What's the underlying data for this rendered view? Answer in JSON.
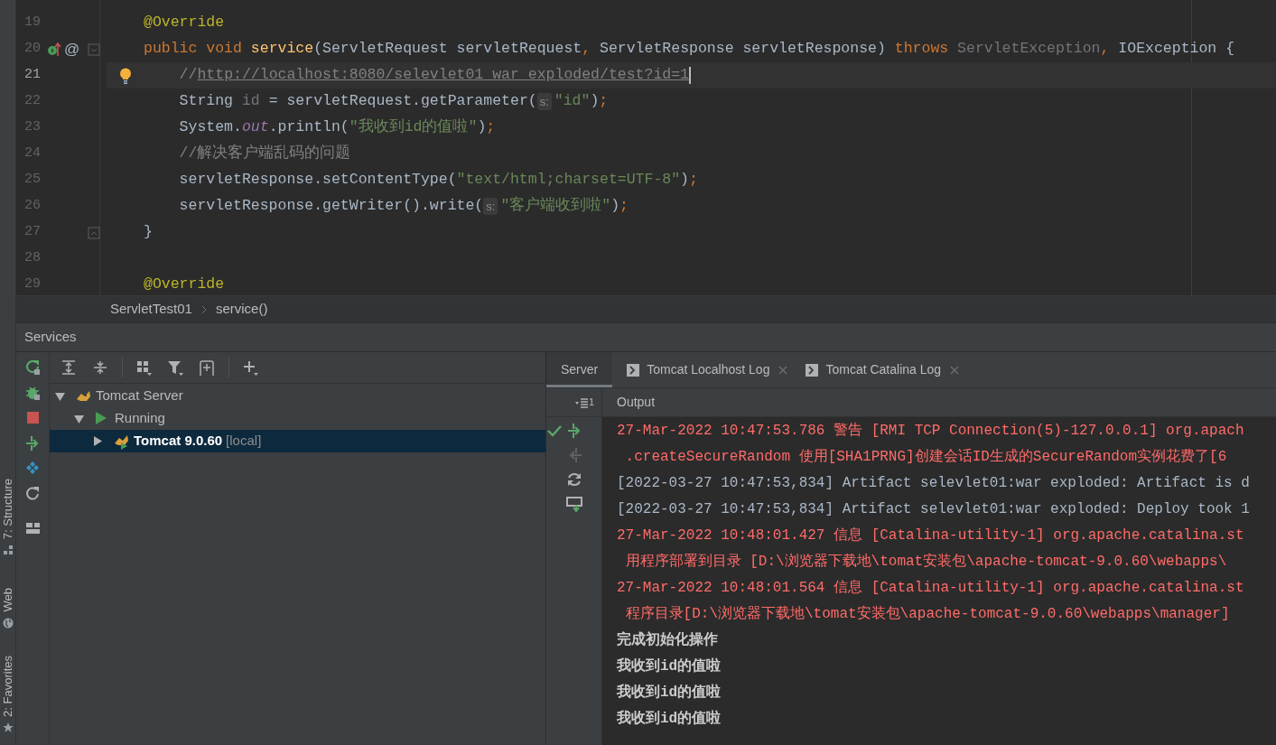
{
  "editor": {
    "lines": [
      {
        "number": "19",
        "current": false,
        "segments": [
          {
            "kind": "annotation",
            "text": "@Override"
          }
        ]
      },
      {
        "number": "20",
        "current": false,
        "override_marker": true,
        "gutter_text": "@",
        "fold_start": true,
        "segments": [
          {
            "kind": "keyword",
            "text": "public void "
          },
          {
            "kind": "method",
            "text": "service"
          },
          {
            "kind": "plain",
            "text": "(ServletRequest servletRequest"
          },
          {
            "kind": "keyword",
            "text": ", "
          },
          {
            "kind": "plain",
            "text": "ServletResponse servletResponse) "
          },
          {
            "kind": "keyword",
            "text": "throws "
          },
          {
            "kind": "unused",
            "text": "ServletException"
          },
          {
            "kind": "keyword",
            "text": ", "
          },
          {
            "kind": "plain",
            "text": "IOException {"
          }
        ]
      },
      {
        "number": "21",
        "current": true,
        "bulb": true,
        "segments": [
          {
            "kind": "comment",
            "text": "    //"
          },
          {
            "kind": "link",
            "text": "http://localhost:8080/selevlet01_war_exploded/test?id=1"
          }
        ]
      },
      {
        "number": "22",
        "current": false,
        "segments": [
          {
            "kind": "plain",
            "text": "    String "
          },
          {
            "kind": "unused",
            "text": "id"
          },
          {
            "kind": "plain",
            "text": " = servletRequest.getParameter("
          },
          {
            "kind": "hint",
            "text": "s:"
          },
          {
            "kind": "string",
            "text": "\"id\""
          },
          {
            "kind": "plain",
            "text": ")"
          },
          {
            "kind": "keyword",
            "text": ";"
          }
        ]
      },
      {
        "number": "23",
        "current": false,
        "segments": [
          {
            "kind": "plain",
            "text": "    System."
          },
          {
            "kind": "field",
            "text": "out"
          },
          {
            "kind": "plain",
            "text": ".println("
          },
          {
            "kind": "string",
            "text": "\"我收到id的值啦\""
          },
          {
            "kind": "plain",
            "text": ")"
          },
          {
            "kind": "keyword",
            "text": ";"
          }
        ]
      },
      {
        "number": "24",
        "current": false,
        "segments": [
          {
            "kind": "comment",
            "text": "    //解决客户端乱码的问题"
          }
        ]
      },
      {
        "number": "25",
        "current": false,
        "segments": [
          {
            "kind": "plain",
            "text": "    servletResponse.setContentType("
          },
          {
            "kind": "string",
            "text": "\"text/html;charset=UTF-8\""
          },
          {
            "kind": "plain",
            "text": ")"
          },
          {
            "kind": "keyword",
            "text": ";"
          }
        ]
      },
      {
        "number": "26",
        "current": false,
        "segments": [
          {
            "kind": "plain",
            "text": "    servletResponse.getWriter().write("
          },
          {
            "kind": "hint",
            "text": "s:"
          },
          {
            "kind": "string",
            "text": "\"客户端收到啦\""
          },
          {
            "kind": "plain",
            "text": ")"
          },
          {
            "kind": "keyword",
            "text": ";"
          }
        ]
      },
      {
        "number": "27",
        "current": false,
        "fold_end": true,
        "segments": [
          {
            "kind": "plain",
            "text": "}"
          }
        ]
      },
      {
        "number": "28",
        "current": false
      },
      {
        "number": "29",
        "current": false,
        "segments": [
          {
            "kind": "annotation",
            "text": "@Override"
          }
        ]
      }
    ]
  },
  "breadcrumb": [
    "ServletTest01",
    "service()"
  ],
  "services": {
    "title": "Services",
    "tree": [
      {
        "kind": "server",
        "label": "Tomcat Server",
        "expanded": true,
        "selected": false,
        "children": [
          {
            "kind": "state",
            "label": "Running",
            "expanded": true,
            "selected": false,
            "children": [
              {
                "kind": "instance",
                "label": "Tomcat 9.0.60",
                "detail": "[local]",
                "expanded": false,
                "selected": true
              }
            ]
          }
        ]
      }
    ]
  },
  "tabs": [
    {
      "label": "Server",
      "selected": true,
      "kind": "plain"
    },
    {
      "label": "Tomcat Localhost Log",
      "selected": false,
      "kind": "log"
    },
    {
      "label": "Tomcat Catalina Log",
      "selected": false,
      "kind": "log"
    }
  ],
  "output": {
    "title": "Output",
    "count": "1",
    "lines": [
      {
        "kind": "error",
        "text": "27-Mar-2022 10:47:53.786 警告 [RMI TCP Connection(5)-127.0.0.1] org.apach"
      },
      {
        "kind": "error",
        "text": " .createSecureRandom 使用[SHA1PRNG]创建会话ID生成的SecureRandom实例花费了[6"
      },
      {
        "kind": "info",
        "text": "[2022-03-27 10:47:53,834] Artifact selevlet01:war exploded: Artifact is d"
      },
      {
        "kind": "info",
        "text": "[2022-03-27 10:47:53,834] Artifact selevlet01:war exploded: Deploy took 1"
      },
      {
        "kind": "error",
        "text": "27-Mar-2022 10:48:01.427 信息 [Catalina-utility-1] org.apache.catalina.st"
      },
      {
        "kind": "error",
        "text": " 用程序部署到目录 [D:\\浏览器下载地\\tomat安装包\\apache-tomcat-9.0.60\\webapps\\"
      },
      {
        "kind": "error",
        "text": "27-Mar-2022 10:48:01.564 信息 [Catalina-utility-1] org.apache.catalina.st"
      },
      {
        "kind": "error",
        "text": " 程序目录[D:\\浏览器下载地\\tomat安装包\\apache-tomcat-9.0.60\\webapps\\manager]"
      },
      {
        "kind": "stdout",
        "text": "完成初始化操作"
      },
      {
        "kind": "stdout",
        "text": "我收到id的值啦"
      },
      {
        "kind": "stdout",
        "text": "我收到id的值啦"
      },
      {
        "kind": "stdout",
        "text": "我收到id的值啦"
      }
    ]
  },
  "side_labels": [
    "7: Structure",
    "Web",
    "2: Favorites"
  ]
}
